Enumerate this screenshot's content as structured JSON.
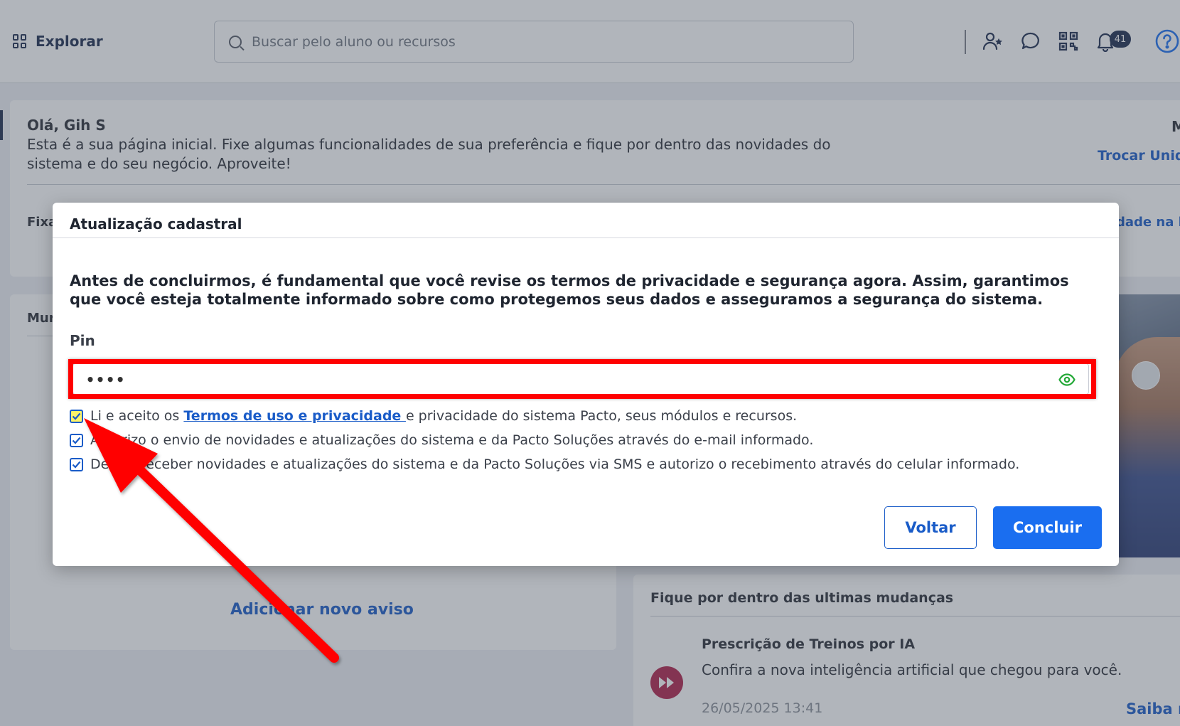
{
  "topbar": {
    "explore_label": "Explorar",
    "search_placeholder": "Buscar pelo aluno ou recursos",
    "notification_count": "41"
  },
  "welcome": {
    "greeting": "Olá, Gih S",
    "text": "Esta é a sua página inicial. Fixe algumas funcionalidades de sua preferência e fique por dentro das novidades do sistema e do seu negócio. Aproveite!",
    "right_initial": "M",
    "switch_unit_link": "Trocar Unida",
    "fixed_section_label": "Fixa",
    "right_link_partial": "dade na h"
  },
  "mural": {
    "title": "Mur",
    "add_notice": "Adicionar novo aviso"
  },
  "news": {
    "title": "Fique por dentro das ultimas mudanças",
    "item_title": "Prescrição de Treinos por IA",
    "item_text": "Confira a nova inteligência artificial que chegou para você.",
    "item_date": "26/05/2025 13:41",
    "more_link": "Saiba m"
  },
  "modal": {
    "title": "Atualização cadastral",
    "intro": "Antes de concluirmos, é fundamental que você revise os termos de privacidade e segurança agora. Assim, garantimos que você esteja totalmente informado sobre como protegemos seus dados e asseguramos a segurança do sistema.",
    "pin_label": "Pin",
    "pin_value": "••••",
    "checks": [
      {
        "prefix": "Li e aceito os ",
        "link": "Termos de uso e privacidade ",
        "suffix": "e privacidade do sistema Pacto, seus módulos e recursos.",
        "checked": true
      },
      {
        "text": "Autorizo o envio de novidades e atualizações do sistema e da Pacto Soluções através do e-mail informado.",
        "checked": true
      },
      {
        "text": "Desejo receber novidades e atualizações do sistema e da Pacto Soluções via SMS e autorizo o recebimento através do celular informado.",
        "checked": true
      }
    ],
    "back_label": "Voltar",
    "done_label": "Concluir"
  },
  "colors": {
    "accent": "#1a5cc8",
    "primary_button": "#1a6ef0",
    "annotation_red": "#ff0000",
    "eye_icon_green": "#22a836",
    "news_icon": "#b0224a"
  },
  "icons": [
    "grid-icon",
    "search-icon",
    "user-star-icon",
    "chat-icon",
    "qr-code-icon",
    "bell-icon",
    "help-icon",
    "eye-icon",
    "checkbox-checked-icon",
    "fast-forward-icon"
  ]
}
